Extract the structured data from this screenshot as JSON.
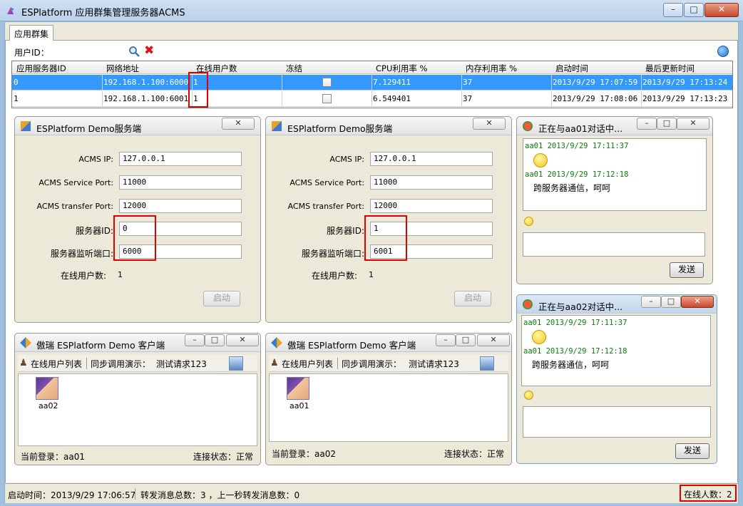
{
  "window": {
    "title": "ESPlatform 应用群集管理服务器ACMS",
    "controls": [
      "minimize",
      "maximize",
      "close"
    ]
  },
  "tabs": [
    {
      "label": "应用群集",
      "active": true
    }
  ],
  "toolbar": {
    "user_id_label": "用户ID：",
    "icons": [
      "search-icon",
      "delete-icon",
      "refresh-icon"
    ]
  },
  "grid": {
    "headers": [
      "应用服务器ID",
      "网络地址",
      "在线用户数",
      "冻结",
      "CPU利用率 %",
      "内存利用率 %",
      "启动时间",
      "最后更新时间"
    ],
    "rows": [
      {
        "id": "0",
        "address": "192.168.1.100:6000",
        "online": "1",
        "frozen": false,
        "cpu": "7.129411",
        "mem": "37",
        "start": "2013/9/29 17:07:59",
        "updated": "2013/9/29 17:13:24",
        "selected": true
      },
      {
        "id": "1",
        "address": "192.168.1.100:6001",
        "online": "1",
        "frozen": false,
        "cpu": "6.549401",
        "mem": "37",
        "start": "2013/9/29 17:08:06",
        "updated": "2013/9/29 17:13:23",
        "selected": false
      }
    ]
  },
  "servers": [
    {
      "title": "ESPlatform Demo服务端",
      "acms_ip_label": "ACMS IP:",
      "acms_ip": "127.0.0.1",
      "service_port_label": "ACMS Service Port:",
      "service_port": "11000",
      "transfer_port_label": "ACMS transfer Port:",
      "transfer_port": "12000",
      "server_id_label": "服务器ID:",
      "server_id": "0",
      "listen_port_label": "服务器监听端口:",
      "listen_port": "6000",
      "online_label": "在线用户数:",
      "online": "1",
      "start_button": "启动"
    },
    {
      "title": "ESPlatform Demo服务端",
      "acms_ip_label": "ACMS IP:",
      "acms_ip": "127.0.0.1",
      "service_port_label": "ACMS Service Port:",
      "service_port": "11000",
      "transfer_port_label": "ACMS transfer Port:",
      "transfer_port": "12000",
      "server_id_label": "服务器ID:",
      "server_id": "1",
      "listen_port_label": "服务器监听端口:",
      "listen_port": "6001",
      "online_label": "在线用户数:",
      "online": "1",
      "start_button": "启动"
    }
  ],
  "clients": [
    {
      "title": "傲瑞 ESPlatform Demo 客户端",
      "tab_online_list": "在线用户列表",
      "sync_call_label": "同步调用演示：",
      "sync_call_value": "测试请求123",
      "user": "aa02",
      "current_login": "当前登录：aa01",
      "conn_status": "连接状态：正常"
    },
    {
      "title": "傲瑞 ESPlatform Demo 客户端",
      "tab_online_list": "在线用户列表",
      "sync_call_label": "同步调用演示：",
      "sync_call_value": "测试请求123",
      "user": "aa01",
      "current_login": "当前登录：aa02",
      "conn_status": "连接状态：正常"
    }
  ],
  "chats": [
    {
      "title": "正在与aa01对话中...",
      "msg1_header": "aa01 2013/9/29 17:11:37",
      "msg2_header": "aa01 2013/9/29 17:12:18",
      "msg2_text": "跨服务器通信，呵呵",
      "send_button": "发送"
    },
    {
      "title": "正在与aa02对话中...",
      "msg1_header": "aa01 2013/9/29 17:11:37",
      "msg2_header": "aa01 2013/9/29 17:12:18",
      "msg2_text": "跨服务器通信，呵呵",
      "send_button": "发送"
    }
  ],
  "status": {
    "start_time": "启动时间：2013/9/29 17:06:57",
    "forward_total": "转发消息总数：3 ，上一秒转发消息数：0",
    "online_count": "在线人数：2"
  }
}
